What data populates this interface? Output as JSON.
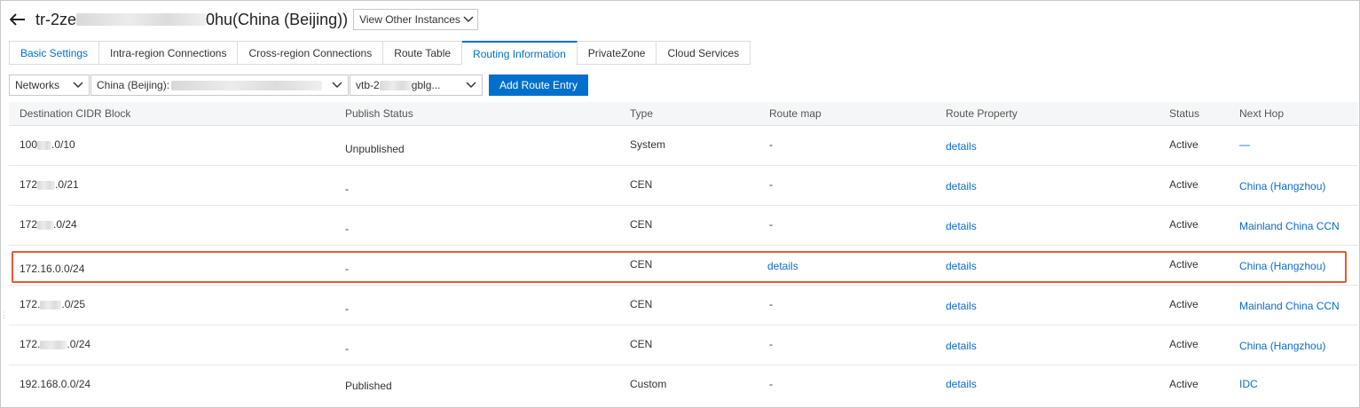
{
  "header": {
    "title_prefix": "tr-2ze",
    "title_suffix": "0hu(China (Beijing))",
    "view_other": "View Other Instances"
  },
  "tabs": [
    {
      "label": "Basic Settings"
    },
    {
      "label": "Intra-region Connections"
    },
    {
      "label": "Cross-region Connections"
    },
    {
      "label": "Route Table"
    },
    {
      "label": "Routing Information"
    },
    {
      "label": "PrivateZone"
    },
    {
      "label": "Cloud Services"
    }
  ],
  "filters": {
    "network_type": "Networks",
    "network_prefix": "China (Beijing):",
    "vtb_prefix": "vtb-2",
    "vtb_suffix": "gblg...",
    "add_button": "Add Route Entry"
  },
  "table": {
    "headers": [
      "Destination CIDR Block",
      "Publish Status",
      "Type",
      "Route map",
      "Route Property",
      "Status",
      "Next Hop"
    ],
    "rows": [
      {
        "cidr_a": "100",
        "cidr_b": ".0/10",
        "publish": "Unpublished",
        "type": "System",
        "route_map": "-",
        "route_property": "details",
        "status": "Active",
        "next_hop": "—"
      },
      {
        "cidr_a": "172",
        "cidr_b": ".0/21",
        "publish": "-",
        "type": "CEN",
        "route_map": "-",
        "route_property": "details",
        "status": "Active",
        "next_hop": "China (Hangzhou)"
      },
      {
        "cidr_a": "172",
        "cidr_b": ".0/24",
        "publish": "-",
        "type": "CEN",
        "route_map": "-",
        "route_property": "details",
        "status": "Active",
        "next_hop": "Mainland China CCN"
      },
      {
        "cidr_a": "172.16.0.0/24",
        "cidr_b": "",
        "publish": "-",
        "type": "CEN",
        "route_map": "details",
        "route_property": "details",
        "status": "Active",
        "next_hop": "China (Hangzhou)"
      },
      {
        "cidr_a": "172.",
        "cidr_b": ".0/25",
        "publish": "-",
        "type": "CEN",
        "route_map": "-",
        "route_property": "details",
        "status": "Active",
        "next_hop": "Mainland China CCN"
      },
      {
        "cidr_a": "172.",
        "cidr_b": ".0/24",
        "publish": "-",
        "type": "CEN",
        "route_map": "-",
        "route_property": "details",
        "status": "Active",
        "next_hop": "China (Hangzhou)"
      },
      {
        "cidr_a": "192.168.0.0/24",
        "cidr_b": "",
        "publish": "Published",
        "type": "Custom",
        "route_map": "-",
        "route_property": "details",
        "status": "Active",
        "next_hop": "IDC"
      }
    ]
  },
  "colors": {
    "accent": "#0070cc",
    "highlight": "#e45b38"
  }
}
